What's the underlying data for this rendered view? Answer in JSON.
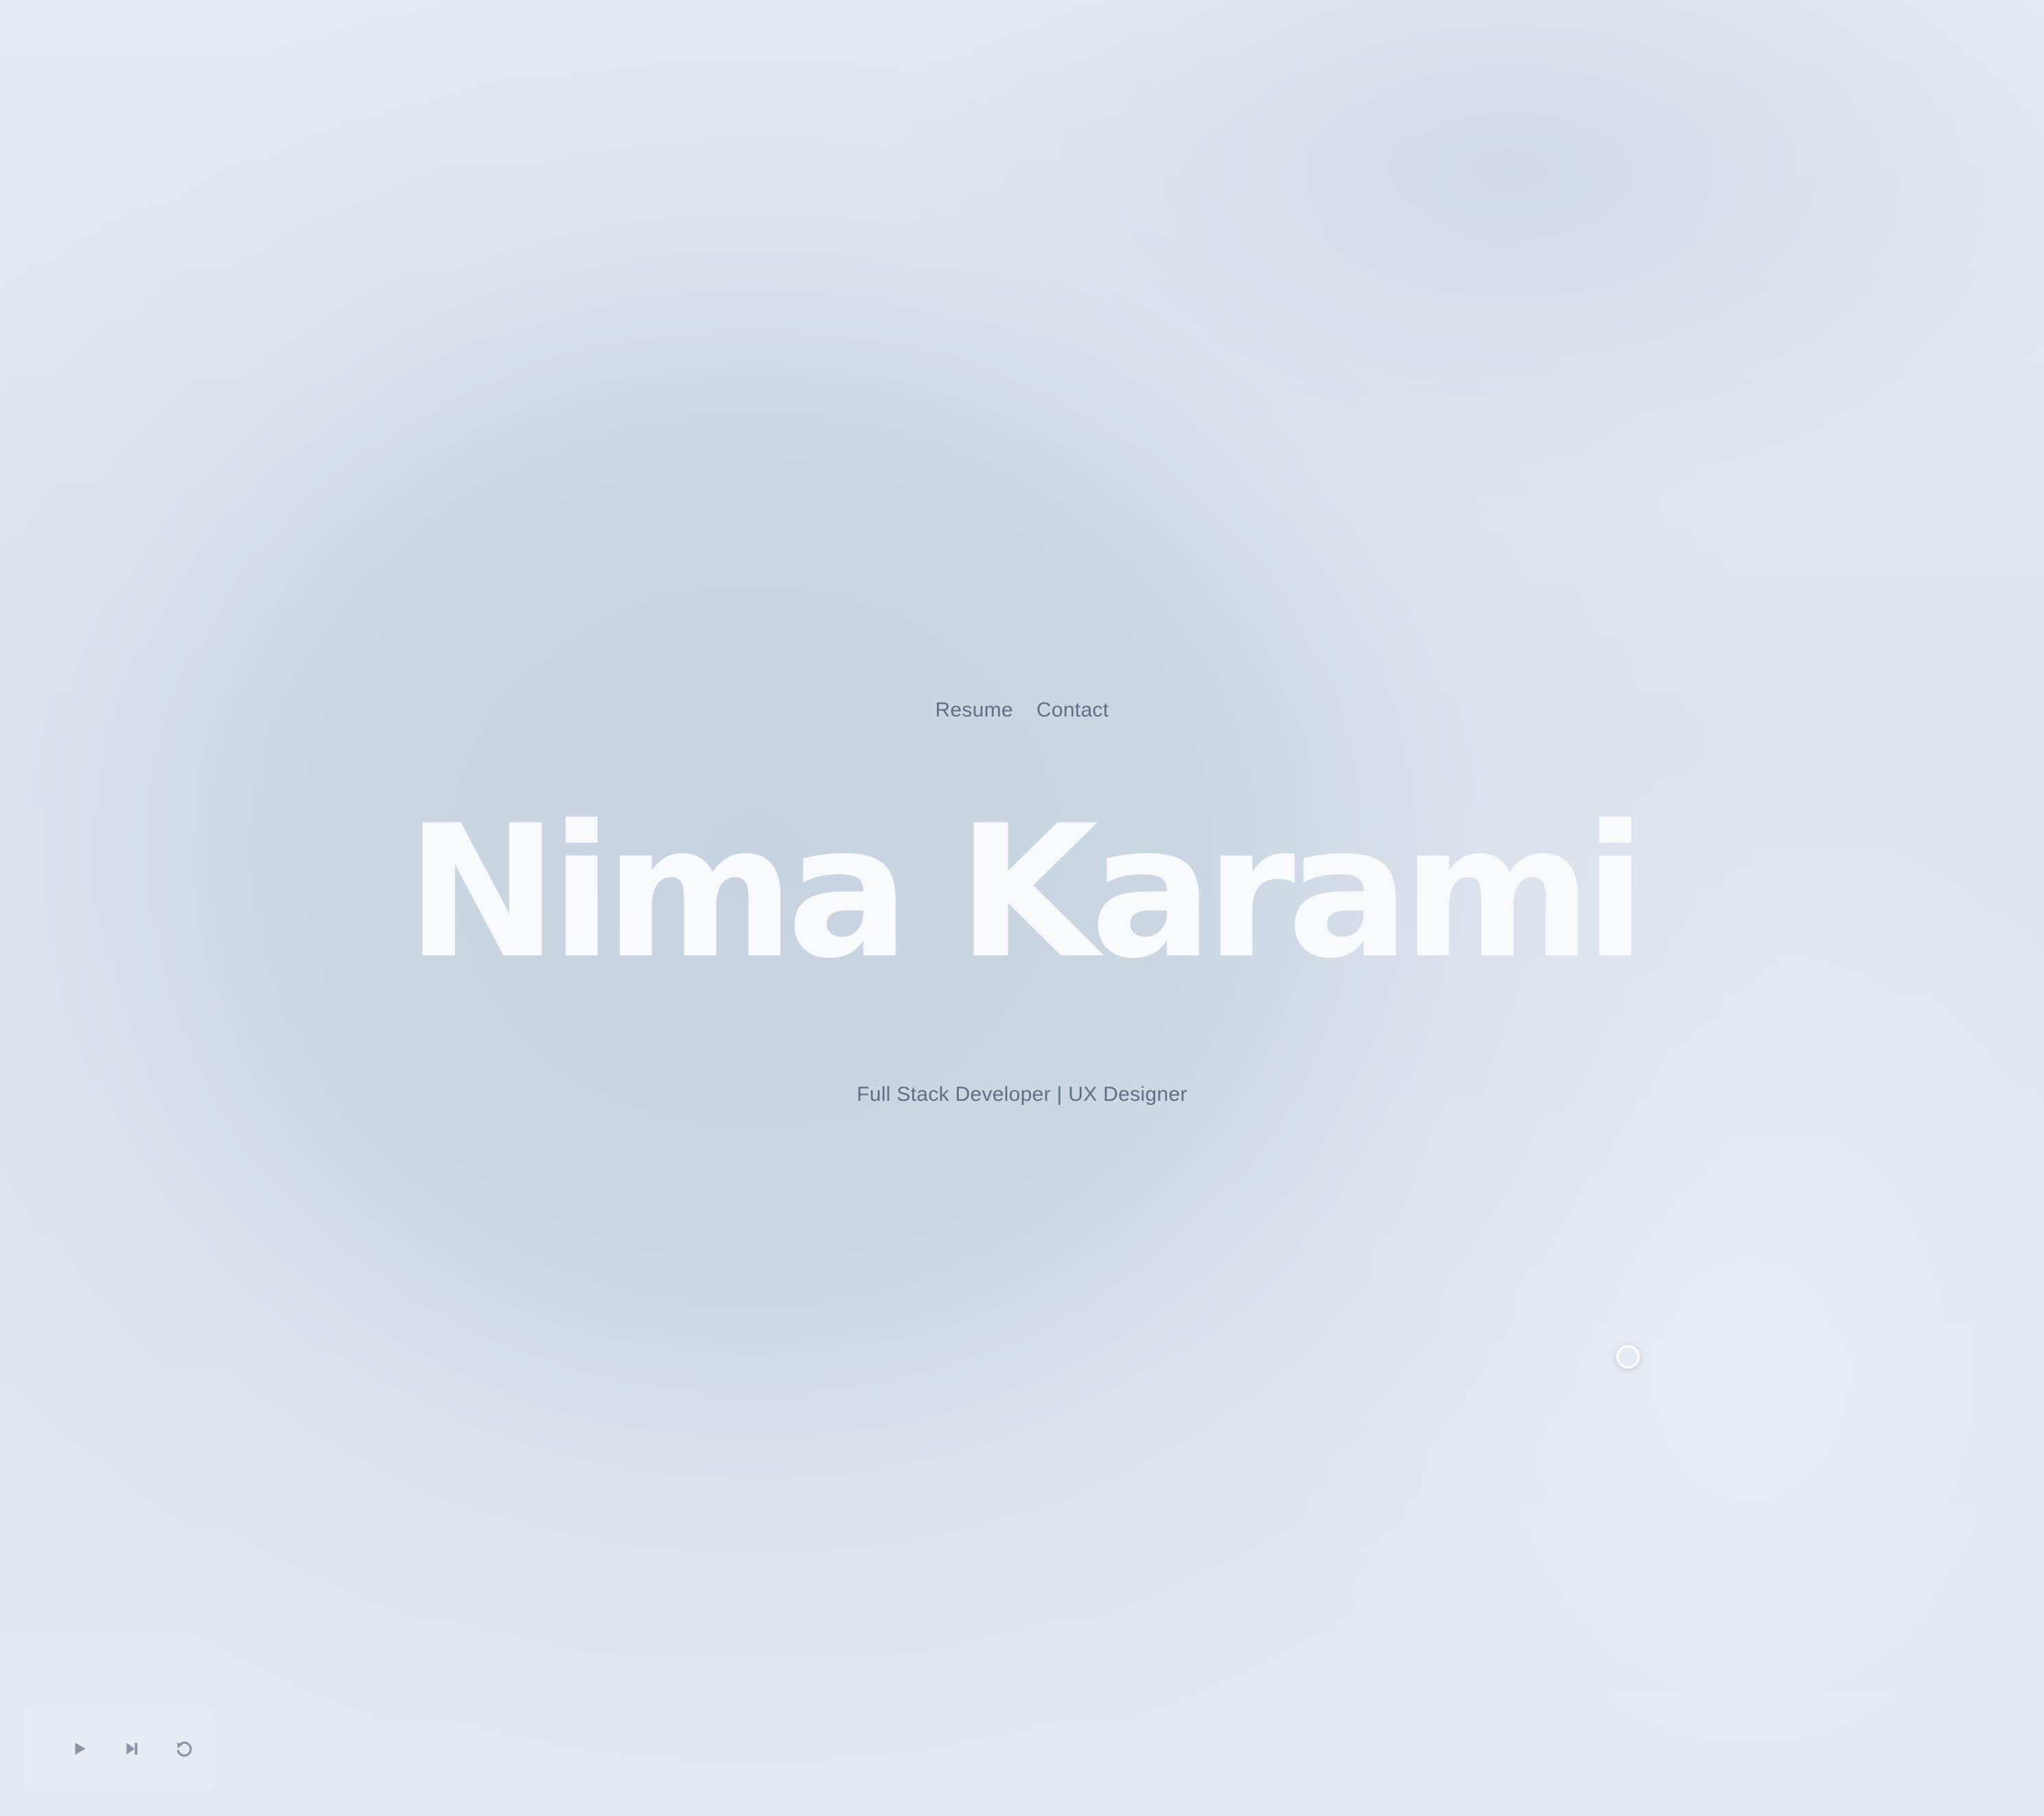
{
  "nav": {
    "items": [
      {
        "label": "Resume"
      },
      {
        "label": "Contact"
      }
    ]
  },
  "hero": {
    "name": "Nima Karami",
    "tagline": "Full Stack Developer | UX Designer"
  },
  "controls": {
    "buttons": [
      {
        "icon": "play-icon"
      },
      {
        "icon": "skip-next-icon"
      },
      {
        "icon": "replay-icon"
      }
    ]
  },
  "colors": {
    "background": "#cbd5e1",
    "title": "#f7f9fb",
    "text": "#5f6f85",
    "icon": "#8a96a8"
  }
}
